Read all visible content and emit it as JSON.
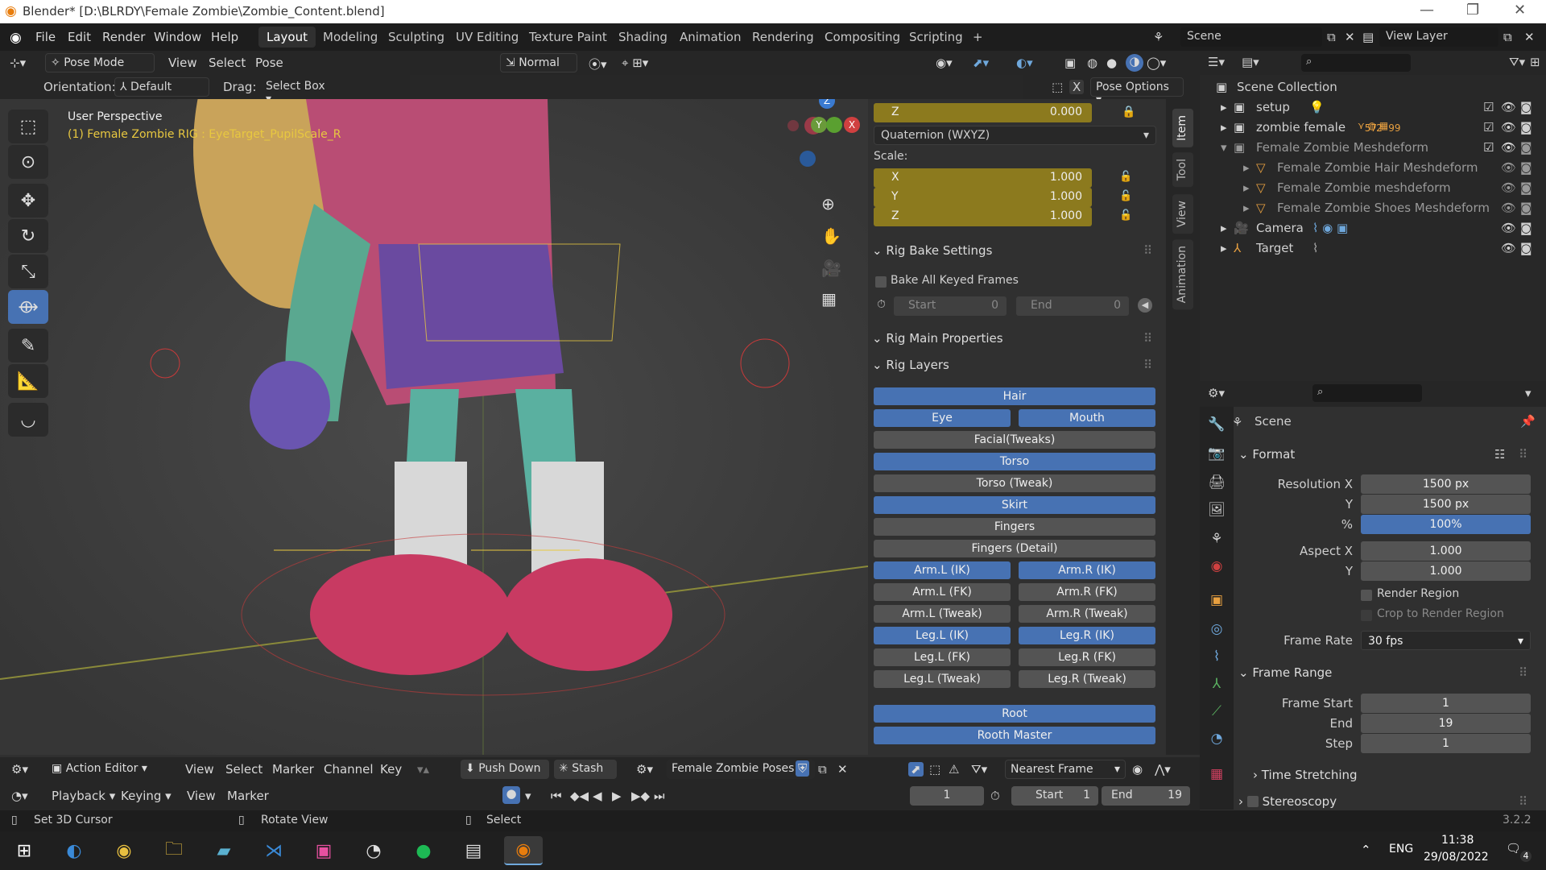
{
  "window": {
    "title": "Blender* [D:\\BLRDY\\Female Zombie\\Zombie_Content.blend]"
  },
  "menu": {
    "file": "File",
    "edit": "Edit",
    "render": "Render",
    "window": "Window",
    "help": "Help"
  },
  "workspaces": [
    "Layout",
    "Modeling",
    "Sculpting",
    "UV Editing",
    "Texture Paint",
    "Shading",
    "Animation",
    "Rendering",
    "Compositing",
    "Scripting"
  ],
  "workspace_add": "+",
  "scene_selector": "Scene",
  "view_layer": "View Layer",
  "viewport_header": {
    "mode": "Pose Mode",
    "view": "View",
    "select": "Select",
    "pose": "Pose",
    "orientation_transform": "Normal",
    "orientation_label": "Orientation:",
    "orientation_value": "Default",
    "drag_label": "Drag:",
    "drag_value": "Select Box",
    "pose_options": "Pose Options",
    "x_toggle": "X"
  },
  "viewport": {
    "perspective": "User Perspective",
    "active_object": "(1) Female Zombie RIG : EyeTarget_PupilScale_R",
    "gizmo": {
      "x": "X",
      "y": "Y",
      "z": "Z"
    }
  },
  "npanel": {
    "tabs": [
      "Item",
      "Tool",
      "View",
      "Animation"
    ],
    "z_field": {
      "label": "Z",
      "value": "0.000"
    },
    "rotation_mode": "Quaternion (WXYZ)",
    "scale_label": "Scale:",
    "scale": [
      {
        "label": "X",
        "value": "1.000"
      },
      {
        "label": "Y",
        "value": "1.000"
      },
      {
        "label": "Z",
        "value": "1.000"
      }
    ],
    "rig_bake_title": "Rig Bake Settings",
    "bake_all": "Bake All Keyed Frames",
    "bake_start_label": "Start",
    "bake_start": "0",
    "bake_end_label": "End",
    "bake_end": "0",
    "rig_main_title": "Rig Main Properties",
    "rig_layers_title": "Rig Layers",
    "layers": [
      {
        "label": "Hair",
        "on": true
      },
      {
        "label": "Eye",
        "on": true
      },
      {
        "label": "Mouth",
        "on": true
      },
      {
        "label": "Facial(Tweaks)",
        "on": false
      },
      {
        "label": "Torso",
        "on": true
      },
      {
        "label": "Torso (Tweak)",
        "on": false
      },
      {
        "label": "Skirt",
        "on": true
      },
      {
        "label": "Fingers",
        "on": false
      },
      {
        "label": "Fingers (Detail)",
        "on": false
      },
      {
        "label": "Arm.L (IK)",
        "on": true
      },
      {
        "label": "Arm.R (IK)",
        "on": true
      },
      {
        "label": "Arm.L (FK)",
        "on": false
      },
      {
        "label": "Arm.R (FK)",
        "on": false
      },
      {
        "label": "Arm.L (Tweak)",
        "on": false
      },
      {
        "label": "Arm.R (Tweak)",
        "on": false
      },
      {
        "label": "Leg.L (IK)",
        "on": true
      },
      {
        "label": "Leg.R (IK)",
        "on": true
      },
      {
        "label": "Leg.L (FK)",
        "on": false
      },
      {
        "label": "Leg.R (FK)",
        "on": false
      },
      {
        "label": "Leg.L (Tweak)",
        "on": false
      },
      {
        "label": "Leg.R (Tweak)",
        "on": false
      },
      {
        "label": "Root",
        "on": true
      },
      {
        "label": "Rooth Master",
        "on": true
      }
    ]
  },
  "outliner": {
    "root": "Scene Collection",
    "items": [
      {
        "label": "setup"
      },
      {
        "label": "zombie female",
        "badge1": "57",
        "badge2": "2",
        "badge3": "99"
      },
      {
        "label": "Female Zombie Meshdeform"
      },
      {
        "label": "Female Zombie Hair Meshdeform"
      },
      {
        "label": "Female Zombie meshdeform"
      },
      {
        "label": "Female Zombie Shoes Meshdeform"
      },
      {
        "label": "Camera"
      },
      {
        "label": "Target"
      }
    ]
  },
  "properties": {
    "context": "Scene",
    "format_title": "Format",
    "resolution_x_label": "Resolution X",
    "resolution_x": "1500 px",
    "resolution_y_label": "Y",
    "resolution_y": "1500 px",
    "percent_label": "%",
    "percent": "100%",
    "aspect_x_label": "Aspect X",
    "aspect_x": "1.000",
    "aspect_y_label": "Y",
    "aspect_y": "1.000",
    "render_region": "Render Region",
    "crop_region": "Crop to Render Region",
    "frame_rate_label": "Frame Rate",
    "frame_rate": "30 fps",
    "frame_range_title": "Frame Range",
    "frame_start_label": "Frame Start",
    "frame_start": "1",
    "end_label": "End",
    "end": "19",
    "step_label": "Step",
    "step": "1",
    "time_stretching": "Time Stretching",
    "stereoscopy": "Stereoscopy"
  },
  "action_editor": {
    "mode": "Action Editor",
    "view": "View",
    "select": "Select",
    "marker": "Marker",
    "channel": "Channel",
    "key": "Key",
    "push_down": "Push Down",
    "stash": "Stash",
    "action": "Female Zombie Poses",
    "snap": "Nearest Frame"
  },
  "timeline": {
    "playback": "Playback",
    "keying": "Keying",
    "view": "View",
    "marker": "Marker",
    "current_frame": "1",
    "start_label": "Start",
    "start": "1",
    "end_label": "End",
    "end": "19"
  },
  "status": {
    "left": "Set 3D Cursor",
    "middle": "Rotate View",
    "right": "Select",
    "version": "3.2.2"
  },
  "taskbar": {
    "lang": "ENG",
    "time": "11:38",
    "date": "29/08/2022",
    "notif": "4"
  },
  "colors": {
    "accent": "#4772b3",
    "yellow_field": "#8c7a1e",
    "bg": "#303030"
  }
}
